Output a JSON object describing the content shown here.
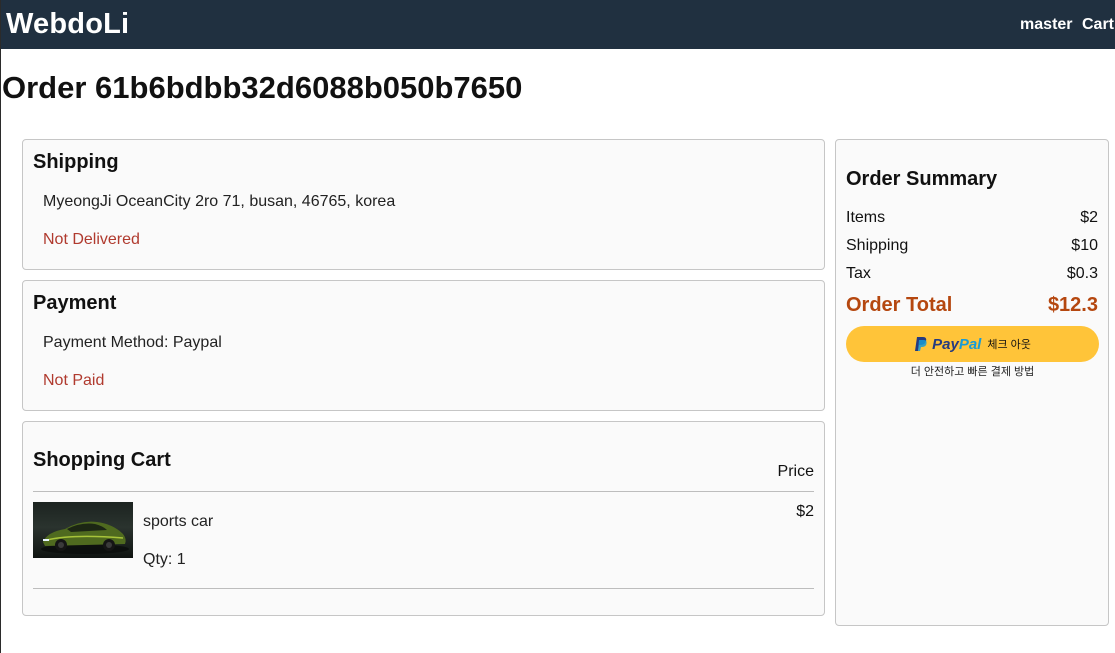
{
  "header": {
    "brand": "WebdoLi",
    "user_menu": "master",
    "cart_link": "Cart"
  },
  "page": {
    "title": "Order 61b6bdbb32d6088b050b7650"
  },
  "shipping": {
    "heading": "Shipping",
    "address": "MyeongJi OceanCity 2ro 71, busan, 46765, korea",
    "status": "Not Delivered"
  },
  "payment": {
    "heading": "Payment",
    "method": "Payment Method: Paypal",
    "status": "Not Paid"
  },
  "cart": {
    "heading": "Shopping Cart",
    "price_header": "Price",
    "items": [
      {
        "name": "sports car",
        "qty": "Qty: 1",
        "price": "$2",
        "image": "sports-car-photo"
      }
    ]
  },
  "summary": {
    "heading": "Order Summary",
    "rows": [
      {
        "label": "Items",
        "value": "$2"
      },
      {
        "label": "Shipping",
        "value": "$10"
      },
      {
        "label": "Tax",
        "value": "$0.3"
      }
    ],
    "total_label": "Order Total",
    "total_value": "$12.3",
    "paypal": {
      "logo_pay": "Pay",
      "logo_pal": "Pal",
      "button_text": "체크 아웃",
      "tagline": "더 안전하고 빠른 결제 방법"
    }
  },
  "colors": {
    "topbar": "#203040",
    "status_red": "#b03a2e",
    "total_orange": "#b5470f",
    "paypal_yellow": "#ffc439"
  }
}
